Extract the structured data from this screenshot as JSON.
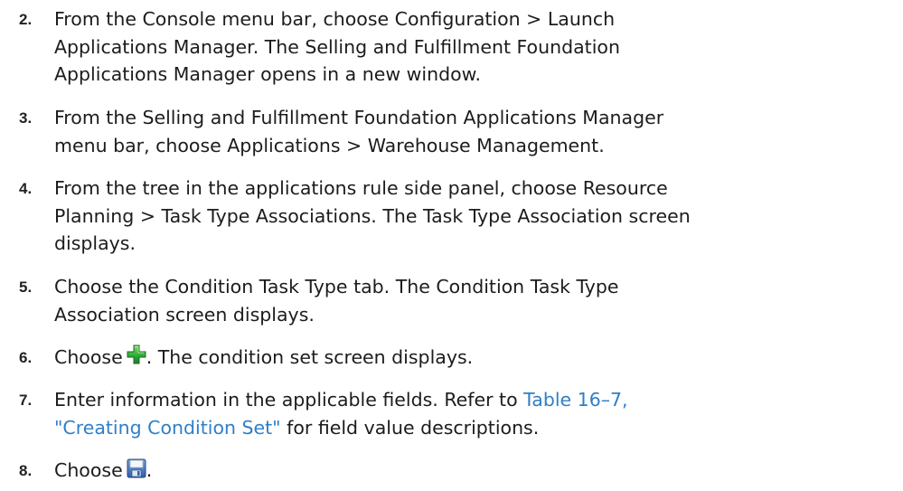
{
  "steps": [
    {
      "number": "2.",
      "lines": [
        "From the Console menu bar, choose Configuration > Launch",
        "Applications Manager. The Selling and Fulfillment Foundation",
        "Applications Manager opens in a new window."
      ]
    },
    {
      "number": "3.",
      "lines": [
        "From the Selling and Fulfillment Foundation Applications Manager",
        "menu bar, choose Applications > Warehouse Management."
      ]
    },
    {
      "number": "4.",
      "lines": [
        "From the tree in the applications rule side panel, choose Resource",
        "Planning > Task Type Associations. The Task Type Association screen",
        "displays."
      ]
    },
    {
      "number": "5.",
      "lines": [
        "Choose the Condition Task Type tab. The Condition Task Type",
        "Association screen displays."
      ]
    },
    {
      "number": "6.",
      "before_icon": "Choose",
      "icon": "green-plus-icon",
      "after_icon": ". The condition set screen displays."
    },
    {
      "number": "7.",
      "line1_text": "Enter information in the applicable fields. Refer to ",
      "line1_link": "Table 16–7,",
      "line2_link": "\"Creating Condition Set\"",
      "line2_text": " for field value descriptions."
    },
    {
      "number": "8.",
      "before_icon": "Choose",
      "icon": "save-disk-icon",
      "after_icon": "."
    }
  ],
  "colors": {
    "link": "#2f7fc7",
    "text": "#1c1c1c",
    "add_icon_green": "#2fae3a",
    "save_icon_blue": "#3a6fb8"
  }
}
